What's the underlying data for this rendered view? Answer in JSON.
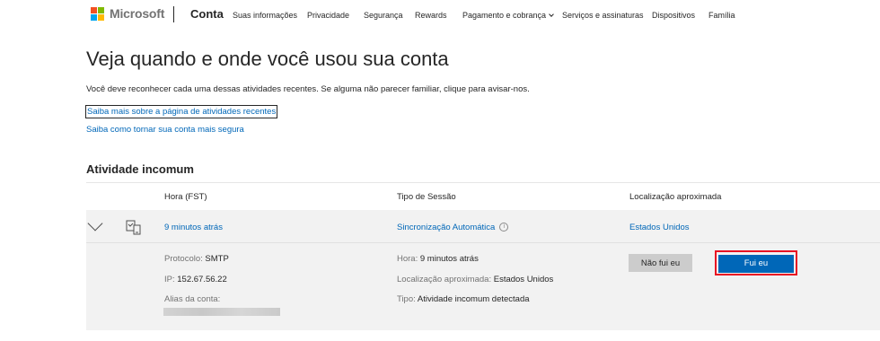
{
  "header": {
    "brand": "Microsoft",
    "section": "Conta",
    "nav": [
      {
        "label": "Suas informações",
        "has_chevron": false
      },
      {
        "label": "Privacidade",
        "has_chevron": false
      },
      {
        "label": "Segurança",
        "has_chevron": false
      },
      {
        "label": "Rewards",
        "has_chevron": false
      },
      {
        "label": "Pagamento e cobrança",
        "has_chevron": true
      },
      {
        "label": "Serviços e assinaturas",
        "has_chevron": false
      },
      {
        "label": "Dispositivos",
        "has_chevron": false
      },
      {
        "label": "Família",
        "has_chevron": false
      }
    ]
  },
  "main": {
    "title": "Veja quando e onde você usou sua conta",
    "intro": "Você deve reconhecer cada uma dessas atividades recentes. Se alguma não parecer familiar, clique para avisar-nos.",
    "link_recent": "Saiba mais sobre a página de atividades recentes",
    "link_secure": "Saiba como tornar sua conta mais segura",
    "section_title": "Atividade incomum"
  },
  "table": {
    "headers": [
      "Hora (FST)",
      "Tipo de Sessão",
      "Localização aproximada"
    ],
    "row": {
      "time": "9 minutos atrás",
      "session_type": "Sincronização Automática",
      "location": "Estados Unidos"
    },
    "details": {
      "protocol_label": "Protocolo:",
      "protocol_value": "SMTP",
      "ip_label": "IP:",
      "ip_value": "152.67.56.22",
      "alias_label": "Alias da conta:",
      "time_label": "Hora:",
      "time_value": "9 minutos atrás",
      "loc_label": "Localização aproximada:",
      "loc_value": "Estados Unidos",
      "type_label": "Tipo:",
      "type_value": "Atividade incomum detectada"
    },
    "buttons": {
      "not_me": "Não fui eu",
      "its_me": "Fui eu"
    }
  },
  "colors": {
    "link": "#0067b8",
    "primary_button": "#0067b8",
    "highlight_border": "#e81123",
    "row_bg": "#f2f2f2"
  }
}
